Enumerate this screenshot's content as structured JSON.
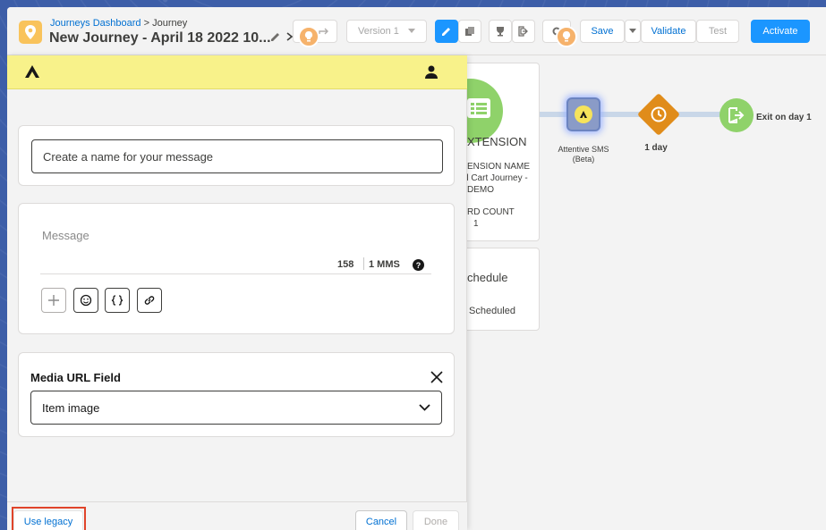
{
  "header": {
    "breadcrumb_link": "Journeys Dashboard",
    "breadcrumb_sep": ">",
    "breadcrumb_current": "Journey",
    "title": "New Journey - April 18 2022 10...",
    "version_label": "Version 1",
    "save_label": "Save",
    "validate_label": "Validate",
    "test_label": "Test",
    "activate_label": "Activate"
  },
  "canvas": {
    "extension_title": "XTENSION",
    "extension_name_label": "ENSION NAME",
    "extension_name_value_1": "d Cart Journey -",
    "extension_name_value_2": "DEMO",
    "record_count_label": "RD COUNT",
    "record_count_value": "1",
    "schedule_title": "chedule",
    "schedule_status": "Scheduled",
    "sms_node_label_1": "Attentive SMS",
    "sms_node_label_2": "(Beta)",
    "wait_label": "1 day",
    "exit_label": "Exit on day 1"
  },
  "panel": {
    "name_placeholder": "Create a name for your message",
    "message_placeholder": "Message",
    "char_count": "158",
    "mms_label": "1 MMS",
    "media_field_label": "Media URL Field",
    "media_field_value": "Item image",
    "use_legacy_label": "Use legacy",
    "cancel_label": "Cancel",
    "done_label": "Done"
  },
  "colors": {
    "accent_yellow": "#f8f28a",
    "primary_blue": "#1b96ff",
    "highlight_red": "#e0442a"
  }
}
